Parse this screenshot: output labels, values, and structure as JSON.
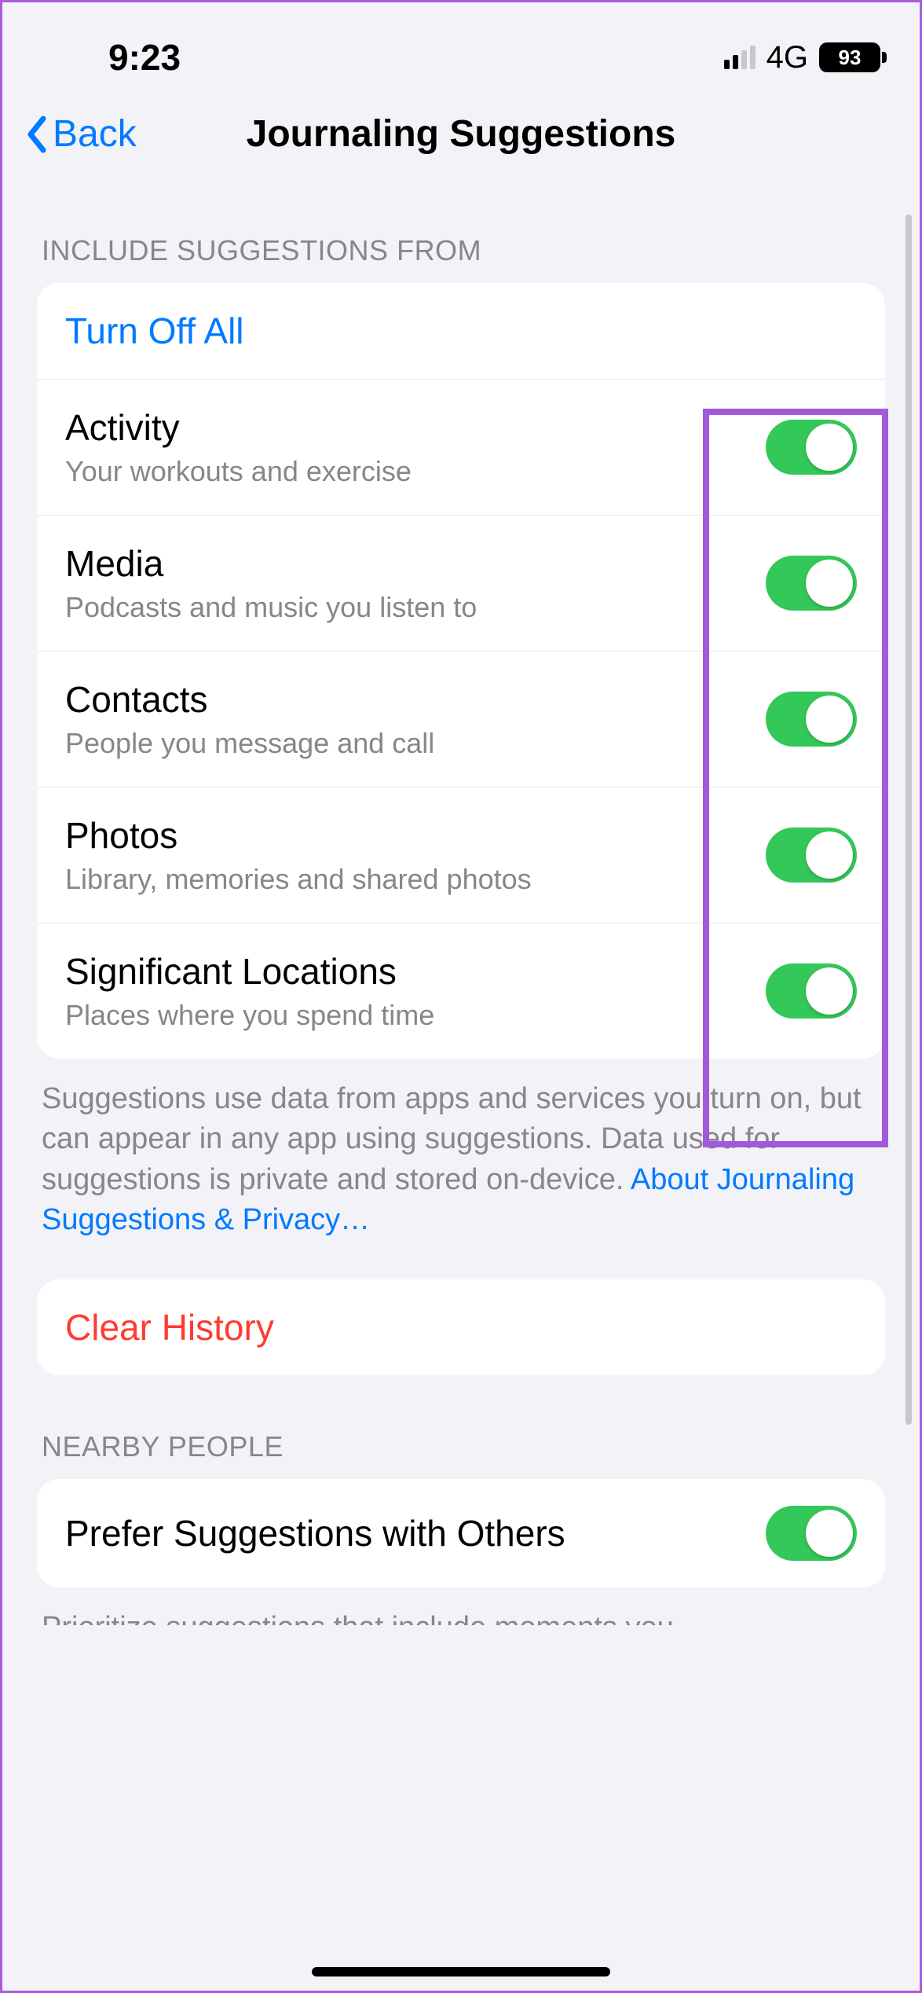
{
  "status": {
    "time": "9:23",
    "network": "4G",
    "battery": "93"
  },
  "nav": {
    "back": "Back",
    "title": "Journaling Suggestions"
  },
  "section1": {
    "header": "INCLUDE SUGGESTIONS FROM",
    "turn_off": "Turn Off All",
    "items": [
      {
        "title": "Activity",
        "subtitle": "Your workouts and exercise",
        "on": true
      },
      {
        "title": "Media",
        "subtitle": "Podcasts and music you listen to",
        "on": true
      },
      {
        "title": "Contacts",
        "subtitle": "People you message and call",
        "on": true
      },
      {
        "title": "Photos",
        "subtitle": "Library, memories and shared photos",
        "on": true
      },
      {
        "title": "Significant Locations",
        "subtitle": "Places where you spend time",
        "on": true
      }
    ],
    "footer_pre": "Suggestions use data from apps and services you turn on, but can appear in any app using suggestions. Data used for suggestions is private and stored on-device. ",
    "footer_link": "About Journaling Suggestions & Privacy…"
  },
  "clear_history": "Clear History",
  "section2": {
    "header": "NEARBY PEOPLE",
    "item": {
      "title": "Prefer Suggestions with Others",
      "on": true
    },
    "footer": "Prioritize suggestions that include moments you"
  }
}
